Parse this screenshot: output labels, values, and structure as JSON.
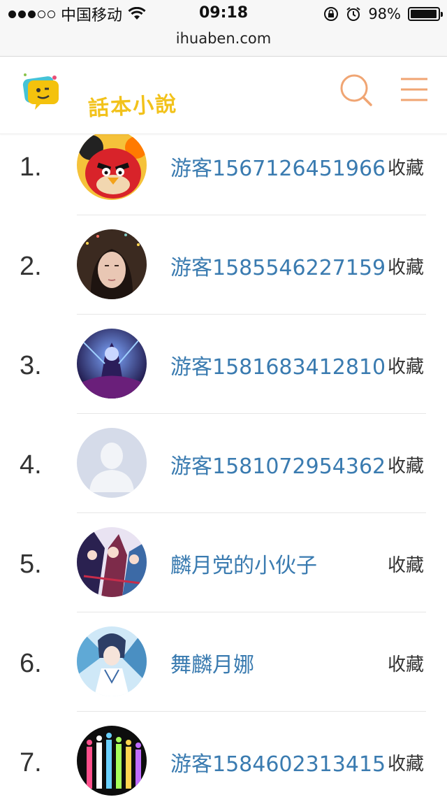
{
  "status_bar": {
    "carrier": "中国移动",
    "time": "09:18",
    "battery": "98%",
    "battery_level": 0.98
  },
  "browser": {
    "url": "ihuaben.com"
  },
  "header": {
    "logo_text": "話本小說",
    "icons": [
      "search-icon",
      "menu-icon"
    ]
  },
  "list": {
    "items": [
      {
        "rank": "1.",
        "name": "游客1567126451966",
        "action": "收藏",
        "avatar": "angry-bird"
      },
      {
        "rank": "2.",
        "name": "游客1585546227159",
        "action": "收藏",
        "avatar": "portrait"
      },
      {
        "rank": "3.",
        "name": "游客1581683412810",
        "action": "收藏",
        "avatar": "game-art"
      },
      {
        "rank": "4.",
        "name": "游客1581072954362",
        "action": "收藏",
        "avatar": "default"
      },
      {
        "rank": "5.",
        "name": "麟月党的小伙子",
        "action": "收藏",
        "avatar": "anime-group"
      },
      {
        "rank": "6.",
        "name": "舞麟月娜",
        "action": "收藏",
        "avatar": "anime-blue"
      },
      {
        "rank": "7.",
        "name": "游客1584602313415",
        "action": "收藏",
        "avatar": "silhouettes"
      }
    ]
  },
  "colors": {
    "link": "#3a7bb0",
    "accent_orange": "#f0a573",
    "logo_yellow": "#f2c21b"
  }
}
